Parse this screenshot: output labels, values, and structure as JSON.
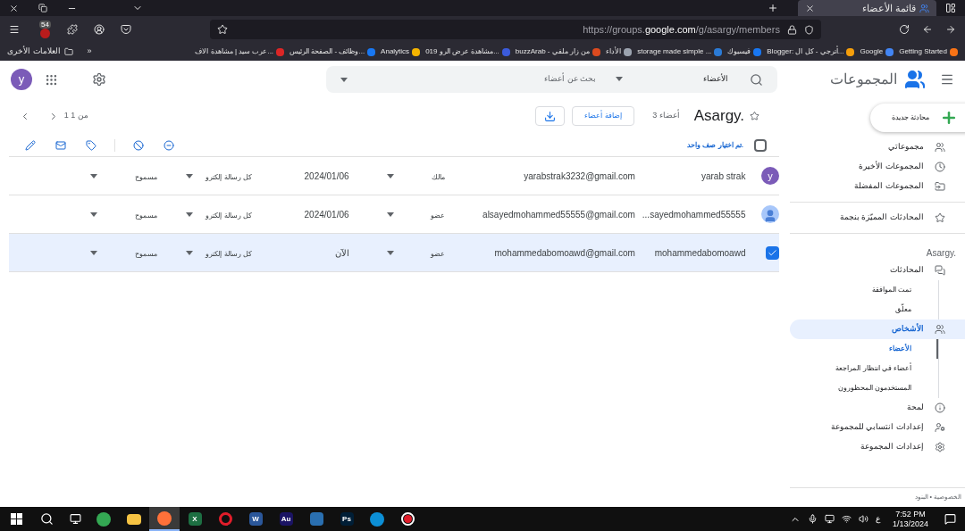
{
  "browser": {
    "tab_title": "قائمة الأعضاء",
    "url_prefix": "https://groups.",
    "url_domain": "google.com",
    "url_path": "/g/asargy/members",
    "extension_badge": "54",
    "bookmarks": [
      {
        "label": "Getting Started",
        "color": "#f97316"
      },
      {
        "label": "Google",
        "color": "#4285f4"
      },
      {
        "label": "Blogger: أترجي - كل ال...",
        "color": "#f59e0b"
      },
      {
        "label": "فيسبوك",
        "color": "#1877f2"
      },
      {
        "label": "storage made simple ...",
        "color": "#2b7bd6"
      },
      {
        "label": "الأداء",
        "color": "#9ca3af"
      },
      {
        "label": "buzzArab - من زار ملفي",
        "color": "#dc4a1f"
      },
      {
        "label": "مشاهدة عرض الرو 019...",
        "color": "#3b5bdb"
      },
      {
        "label": "Analytics",
        "color": "#f4b400"
      },
      {
        "label": "وظائف - الصفحة الرئيس...",
        "color": "#1877f2"
      },
      {
        "label": "عرب سيد | مشاهدة الاف...",
        "color": "#dc2626"
      }
    ],
    "more": "»",
    "other_bookmarks": "العلامات الأخرى"
  },
  "header": {
    "title": "المجموعات",
    "search_scope": "الأعضاء",
    "search_placeholder": "بحث عن أعضاء",
    "avatar": "y"
  },
  "group": {
    "name": "Asargy.",
    "member_count": "3 أعضاء",
    "add_button": "إضافة أعضاء",
    "pagination": "1 من 1",
    "selection_note": "تم اختيار صف واحد.",
    "all_checked": false
  },
  "members": [
    {
      "kind": "letter",
      "initial": "y",
      "name": "yarab strak",
      "email": "yarabstrak3232@gmail.com",
      "role": "مالك",
      "joined": "2024/01/06",
      "delivery": "كل رسالة إلكترو",
      "posting": "مسموح",
      "selected": false
    },
    {
      "kind": "person",
      "name": "...sayedmohammed55555",
      "email": "alsayedmohammed55555@gmail.com",
      "role": "عضو",
      "joined": "2024/01/06",
      "delivery": "كل رسالة إلكترو",
      "posting": "مسموح",
      "selected": false
    },
    {
      "name": "mohammedabomoawd",
      "email": "mohammedabomoawd@gmail.com",
      "role": "عضو",
      "joined": "الآن",
      "delivery": "كل رسالة إلكترو",
      "posting": "مسموح",
      "selected": true
    }
  ],
  "sidebar": {
    "new_button": "محادثة جديدة",
    "top_items": [
      {
        "label": "مجموعاتي",
        "selected": false
      },
      {
        "label": "المجموعات الأخيرة",
        "selected": false
      },
      {
        "label": "المجموعات المفضلة",
        "selected": false
      }
    ],
    "starred": {
      "label": "المحادثات المميّزة بنجمة",
      "selected": false
    },
    "group_label": "Asargy.",
    "group_items": [
      {
        "label": "المحادثات",
        "selected": false,
        "children": [
          {
            "label": "تمت الموافقة",
            "selected": false
          },
          {
            "label": "معلّق",
            "selected": false
          }
        ]
      },
      {
        "label": "الأشخاص",
        "selected": true,
        "children": [
          {
            "label": "الأعضاء",
            "selected": true
          },
          {
            "label": "أعضاء في انتظار المراجعة",
            "selected": false
          },
          {
            "label": "المستخدمون المحظورون",
            "selected": false
          }
        ]
      },
      {
        "label": "لمحة",
        "selected": false
      },
      {
        "label": "إعدادات انتسابي للمجموعة",
        "selected": false
      },
      {
        "label": "إعدادات المجموعة",
        "selected": false
      }
    ],
    "footer": "الخصوصية • البنود"
  },
  "taskbar": {
    "apps": [
      {
        "kind": "record",
        "color": "#e11d2a",
        "active": false
      },
      {
        "kind": "browser",
        "color": "#0c8fd6",
        "active": false
      },
      {
        "kind": "tile",
        "label": "Ps",
        "color": "#001e36",
        "active": false
      },
      {
        "kind": "tile",
        "color": "#2a6fb0",
        "active": false
      },
      {
        "kind": "tile",
        "label": "Au",
        "color": "#1b1464",
        "active": false
      },
      {
        "kind": "tile",
        "label": "W",
        "color": "#2b579a",
        "active": false
      },
      {
        "kind": "ring",
        "color": "#e11d2a",
        "active": false
      },
      {
        "kind": "tile",
        "label": "X",
        "color": "#1d6f42",
        "active": false
      },
      {
        "kind": "browser",
        "color": "#ff7139",
        "active": true
      },
      {
        "kind": "folder",
        "color": "#f6c343",
        "active": false
      },
      {
        "kind": "browser",
        "color": "#34a853",
        "active": false
      }
    ],
    "language": "ع",
    "time": "7:52 PM",
    "date": "1/13/2024"
  }
}
